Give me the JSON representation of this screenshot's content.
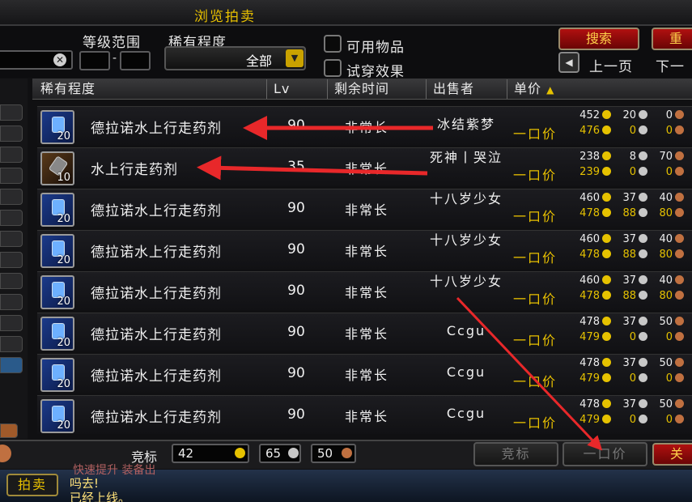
{
  "window": {
    "title": "浏览拍卖"
  },
  "filters": {
    "level_range_label": "等级范围",
    "level_separator": "-",
    "rarity_label": "稀有程度",
    "rarity_value": "全部",
    "usable_label": "可用物品",
    "preview_label": "试穿效果",
    "search_button": "搜索",
    "reset_button": "重",
    "prev_page": "上一页",
    "next_page": "下一"
  },
  "columns": {
    "rarity": "稀有程度",
    "lv": "Lv",
    "time_left": "剩余时间",
    "seller": "出售者",
    "unit_price": "单价"
  },
  "rows": [
    {
      "name": "德拉诺水上行走药剂",
      "count": "20",
      "lv": "90",
      "time": "非常长",
      "seller": "冰结紫梦",
      "buyout": "一口价",
      "bid_g": "452",
      "bid_s": "20",
      "bid_c": "0",
      "bo_g": "476",
      "bo_s": "0",
      "bo_c": "0"
    },
    {
      "name": "水上行走药剂",
      "count": "10",
      "lv": "35",
      "time": "非常长",
      "seller": "死神丨哭泣",
      "buyout": "一口价",
      "bid_g": "238",
      "bid_s": "8",
      "bid_c": "70",
      "bo_g": "239",
      "bo_s": "0",
      "bo_c": "0"
    },
    {
      "name": "德拉诺水上行走药剂",
      "count": "20",
      "lv": "90",
      "time": "非常长",
      "seller": "十八岁少女",
      "buyout": "一口价",
      "bid_g": "460",
      "bid_s": "37",
      "bid_c": "40",
      "bo_g": "478",
      "bo_s": "88",
      "bo_c": "80"
    },
    {
      "name": "德拉诺水上行走药剂",
      "count": "20",
      "lv": "90",
      "time": "非常长",
      "seller": "十八岁少女",
      "buyout": "一口价",
      "bid_g": "460",
      "bid_s": "37",
      "bid_c": "40",
      "bo_g": "478",
      "bo_s": "88",
      "bo_c": "80"
    },
    {
      "name": "德拉诺水上行走药剂",
      "count": "20",
      "lv": "90",
      "time": "非常长",
      "seller": "十八岁少女",
      "buyout": "一口价",
      "bid_g": "460",
      "bid_s": "37",
      "bid_c": "40",
      "bo_g": "478",
      "bo_s": "88",
      "bo_c": "80"
    },
    {
      "name": "德拉诺水上行走药剂",
      "count": "20",
      "lv": "90",
      "time": "非常长",
      "seller": "Ccgu",
      "buyout": "一口价",
      "bid_g": "478",
      "bid_s": "37",
      "bid_c": "50",
      "bo_g": "479",
      "bo_s": "0",
      "bo_c": "0"
    },
    {
      "name": "德拉诺水上行走药剂",
      "count": "20",
      "lv": "90",
      "time": "非常长",
      "seller": "Ccgu",
      "buyout": "一口价",
      "bid_g": "478",
      "bid_s": "37",
      "bid_c": "50",
      "bo_g": "479",
      "bo_s": "0",
      "bo_c": "0"
    },
    {
      "name": "德拉诺水上行走药剂",
      "count": "20",
      "lv": "90",
      "time": "非常长",
      "seller": "Ccgu",
      "buyout": "一口价",
      "bid_g": "478",
      "bid_s": "37",
      "bid_c": "50",
      "bo_g": "479",
      "bo_s": "0",
      "bo_c": "0"
    }
  ],
  "bottom": {
    "bid_label": "竞标",
    "bid_gold": "42",
    "bid_silver": "65",
    "bid_copper": "50",
    "bid_button": "竞标",
    "buyout_button": "一口价",
    "close_button": "关"
  },
  "chat": {
    "tab_label": "拍卖",
    "line1": "快速提升 装备出",
    "line2": "吗去!",
    "line3": "已经上线。"
  },
  "colors": {
    "accent_gold": "#e6c200",
    "search_red": "#b01010",
    "annotation_red": "#e8282a"
  }
}
